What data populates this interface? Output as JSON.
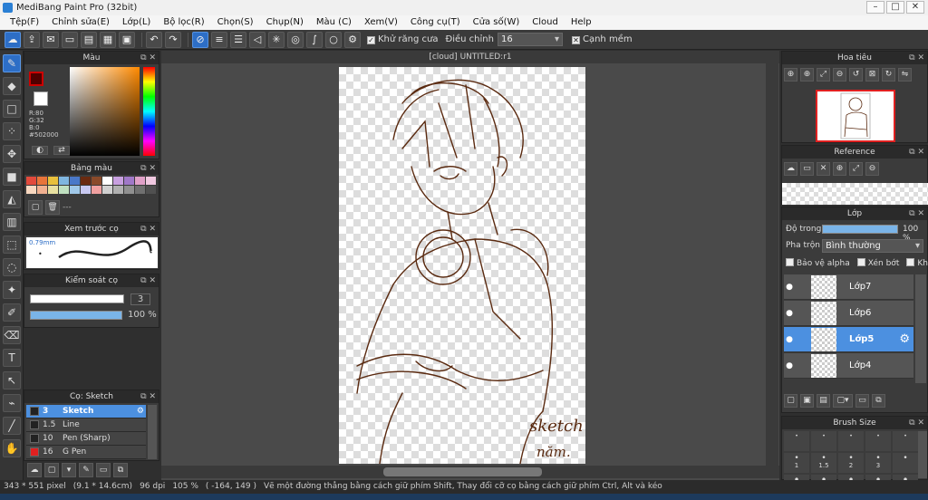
{
  "window": {
    "title": "MediBang Paint Pro (32bit)",
    "minimize": "–",
    "maximize": "□",
    "close": "✕"
  },
  "menu": [
    "Tệp(F)",
    "Chỉnh sửa(E)",
    "Lớp(L)",
    "Bộ lọc(R)",
    "Chọn(S)",
    "Chụp(N)",
    "Màu (C)",
    "Xem(V)",
    "Công cụ(T)",
    "Cửa số(W)",
    "Cloud",
    "Help"
  ],
  "toolbar": {
    "antialias_label": "Khử răng cưa",
    "adjust_label": "Điều chỉnh",
    "adjust_value": "16",
    "smooth_label": "Cạnh mềm",
    "icons": [
      "cloud-icon",
      "export-icon",
      "chat-icon",
      "comment-icon",
      "document-icon",
      "grid-icon",
      "frame-icon",
      "undo-icon",
      "redo-icon",
      "circle-slash-icon",
      "parallel-lines-icon",
      "stack-icon",
      "vanishing-point-icon",
      "radial-icon",
      "concentric-icon",
      "curve-icon",
      "circle-icon",
      "gear-icon"
    ]
  },
  "left_tools": [
    "brush-icon",
    "eraser-icon",
    "rectangle-icon",
    "dot-brush-icon",
    "move-icon",
    "fill-rect-icon",
    "bucket-icon",
    "gradient-icon",
    "select-icon",
    "lasso-icon",
    "magic-wand-icon",
    "select-pen-icon",
    "select-eraser-icon",
    "text-icon",
    "operation-icon",
    "eyedropper-icon",
    "dropper-icon",
    "hand-icon"
  ],
  "color_panel": {
    "title": "Màu",
    "foreground": "#500000",
    "background": "#ffffff",
    "r": "R:80",
    "g": "G:32",
    "b": "B:0",
    "hex": "#502000"
  },
  "palette_panel": {
    "title": "Bảng màu",
    "colors": [
      "#e24a3c",
      "#e8743a",
      "#e8c03c",
      "#7fb6e0",
      "#4a78c8",
      "#6a2a10",
      "#8a4a2a",
      "#ffffff",
      "#c8a0e0",
      "#a078c8",
      "#e0a0c8",
      "#f0c8e0",
      "#f8d8c0",
      "#f0b090",
      "#e8e0a0",
      "#c0e0c0",
      "#a0c8e8",
      "#c8c8f0",
      "#f0a0a0",
      "#d0d0d0",
      "#b0b0b0",
      "#909090",
      "#707070",
      "#505050"
    ],
    "more": "---"
  },
  "brush_preview": {
    "title": "Xem trước cọ",
    "size": "0.79mm"
  },
  "brush_control": {
    "title": "Kiểm soát cọ",
    "size_value": "3",
    "opacity_value": "100 %"
  },
  "brush_list": {
    "title": "Cọ: Sketch",
    "items": [
      {
        "size": "3",
        "name": "Sketch",
        "color": "#1a3a6a"
      },
      {
        "size": "1.5",
        "name": "Line",
        "color": "#222222"
      },
      {
        "size": "10",
        "name": "Pen (Sharp)",
        "color": "#222222"
      },
      {
        "size": "16",
        "name": "G Pen",
        "color": "#e02020"
      }
    ]
  },
  "canvas": {
    "doc_title": "[cloud] UNTITLED:r1",
    "stroke_color": "#5a2a10",
    "text_sketch": "sketch",
    "text_nam": "năm."
  },
  "navigator": {
    "title": "Hoa tiêu"
  },
  "reference": {
    "title": "Reference"
  },
  "layers": {
    "title": "Lớp",
    "opacity_label": "Độ trong",
    "opacity_value": "100 %",
    "blend_label": "Pha trộn",
    "blend_value": "Bình thường",
    "protect_alpha": "Bảo vệ alpha",
    "clip": "Xén bớt",
    "lock": "Khóa",
    "items": [
      {
        "name": "Lớp7",
        "selected": false
      },
      {
        "name": "Lớp6",
        "selected": false
      },
      {
        "name": "Lớp5",
        "selected": true
      },
      {
        "name": "Lớp4",
        "selected": false
      }
    ]
  },
  "brush_size": {
    "title": "Brush Size",
    "sizes": [
      "",
      "",
      "",
      "",
      "",
      "1",
      "1.5",
      "2",
      "3",
      "",
      "",
      "",
      "",
      "",
      ""
    ]
  },
  "status": {
    "dimensions": "343 * 551 pixel",
    "physical": "(9.1 * 14.6cm)",
    "dpi": "96 dpi",
    "zoom": "105 %",
    "cursor": "( -164, 149 )",
    "hint": "Vẽ một đường thẳng bằng cách giữ phím Shift, Thay đổi cỡ cọ bằng cách giữ phím Ctrl, Alt và kéo"
  }
}
